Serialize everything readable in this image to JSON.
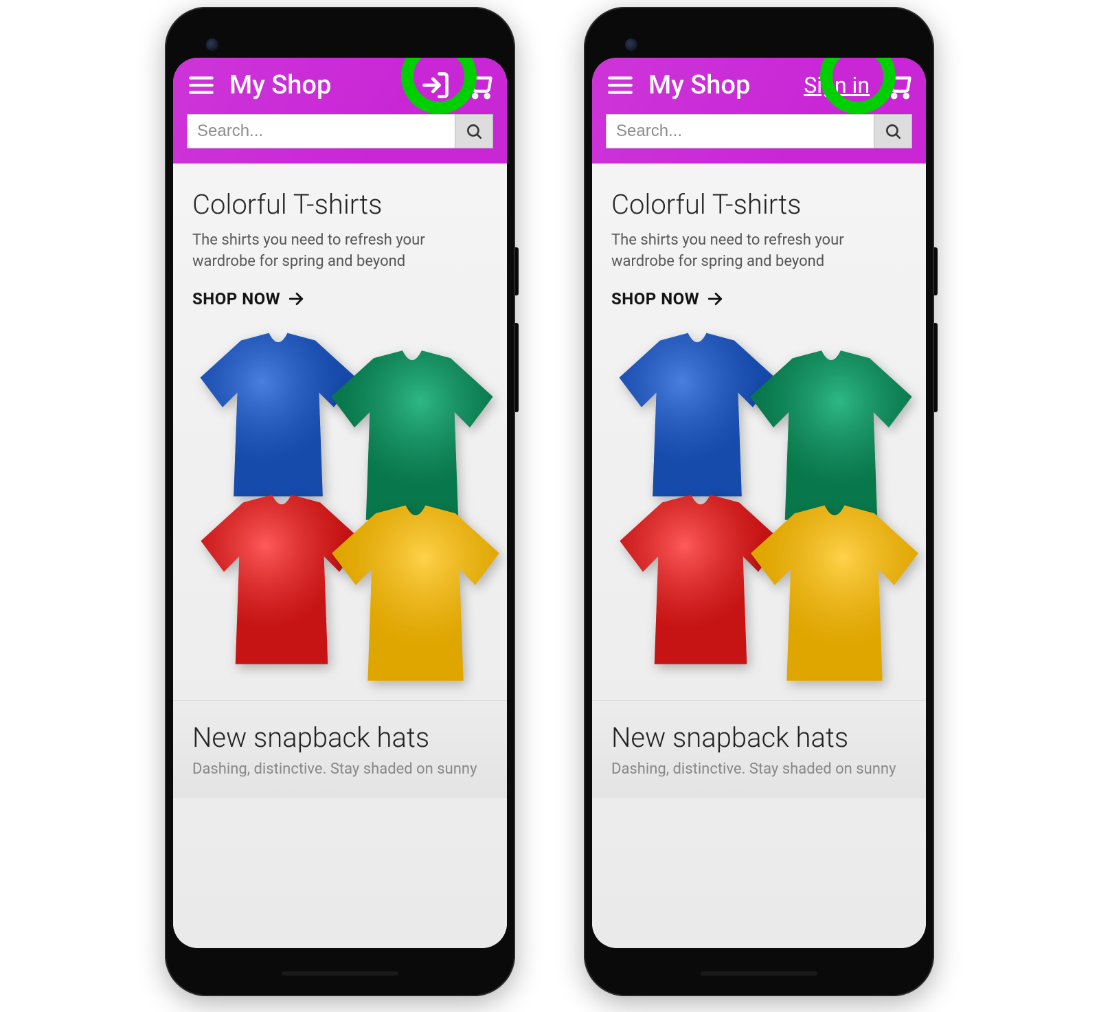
{
  "header": {
    "title": "My Shop",
    "sign_in_label": "Sign in"
  },
  "search": {
    "placeholder": "Search..."
  },
  "hero": {
    "title": "Colorful T-shirts",
    "subtitle": "The shirts you need to refresh your wardrobe for spring and beyond",
    "cta": "SHOP NOW"
  },
  "secondary": {
    "title": "New snapback hats",
    "subtitle": "Dashing, distinctive. Stay shaded on sunny"
  },
  "colors": {
    "accent": "#c927d6",
    "highlight": "#00d000",
    "shirt_blue": "#1c59c4",
    "shirt_green": "#0c8a5a",
    "shirt_red": "#e21b1b",
    "shirt_yellow": "#f5b700"
  }
}
